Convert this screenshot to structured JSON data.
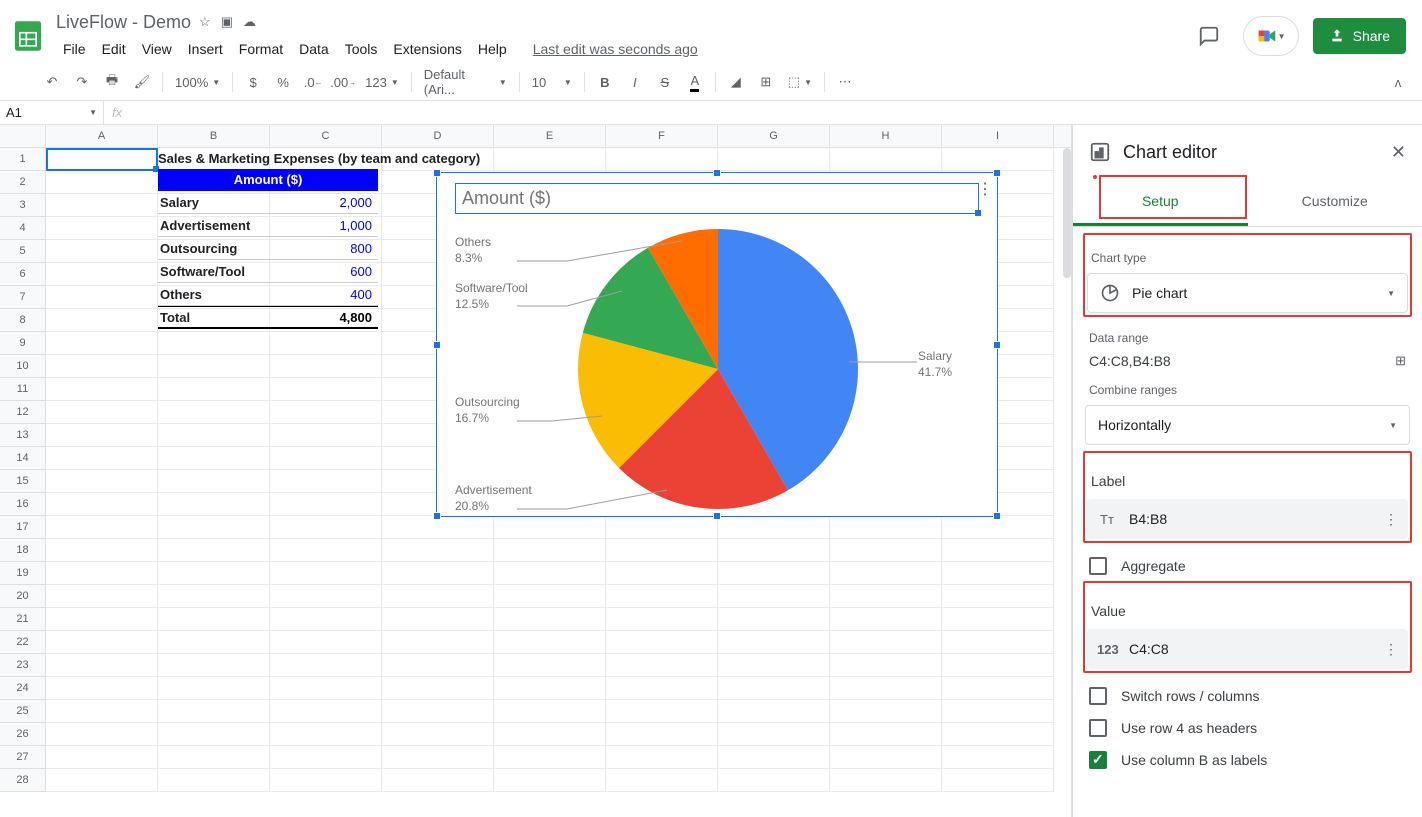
{
  "header": {
    "doc_title": "LiveFlow - Demo",
    "menus": [
      "File",
      "Edit",
      "View",
      "Insert",
      "Format",
      "Data",
      "Tools",
      "Extensions",
      "Help"
    ],
    "last_edit": "Last edit was seconds ago",
    "share_label": "Share"
  },
  "toolbar": {
    "zoom": "100%",
    "font": "Default (Ari...",
    "font_size": "10",
    "formats": [
      "$",
      "%",
      ".0",
      ".00",
      "123"
    ]
  },
  "formula_bar": {
    "name_box": "A1",
    "fx": "fx"
  },
  "grid": {
    "columns": [
      "A",
      "B",
      "C",
      "D",
      "E",
      "F",
      "G",
      "H",
      "I"
    ],
    "row_count": 28
  },
  "data_table": {
    "title": "Sales & Marketing Expenses (by team and category)",
    "header": "Amount ($)",
    "rows": [
      {
        "label": "Salary",
        "value": "2,000"
      },
      {
        "label": "Advertisement",
        "value": "1,000"
      },
      {
        "label": "Outsourcing",
        "value": "800"
      },
      {
        "label": "Software/Tool",
        "value": "600"
      },
      {
        "label": "Others",
        "value": "400"
      }
    ],
    "total_label": "Total",
    "total_value": "4,800"
  },
  "chart": {
    "title": "Amount ($)",
    "labels": {
      "salary": {
        "name": "Salary",
        "pct": "41.7%"
      },
      "advertisement": {
        "name": "Advertisement",
        "pct": "20.8%"
      },
      "outsourcing": {
        "name": "Outsourcing",
        "pct": "16.7%"
      },
      "software": {
        "name": "Software/Tool",
        "pct": "12.5%"
      },
      "others": {
        "name": "Others",
        "pct": "8.3%"
      }
    }
  },
  "chart_data": {
    "type": "pie",
    "title": "Amount ($)",
    "categories": [
      "Salary",
      "Advertisement",
      "Outsourcing",
      "Software/Tool",
      "Others"
    ],
    "values": [
      2000,
      1000,
      800,
      600,
      400
    ],
    "percentages": [
      41.7,
      20.8,
      16.7,
      12.5,
      8.3
    ],
    "colors": [
      "#4285f4",
      "#ea4335",
      "#fbbc04",
      "#34a853",
      "#ff6d01"
    ]
  },
  "sidebar": {
    "title": "Chart editor",
    "tabs": {
      "setup": "Setup",
      "customize": "Customize"
    },
    "chart_type_label": "Chart type",
    "chart_type_value": "Pie chart",
    "data_range_label": "Data range",
    "data_range_value": "C4:C8,B4:B8",
    "combine_label": "Combine ranges",
    "combine_value": "Horizontally",
    "label_section": "Label",
    "label_value": "B4:B8",
    "aggregate_label": "Aggregate",
    "value_section": "Value",
    "value_value": "C4:C8",
    "switch_label": "Switch rows / columns",
    "header_row_label": "Use row 4 as headers",
    "col_labels_label": "Use column B as labels"
  }
}
